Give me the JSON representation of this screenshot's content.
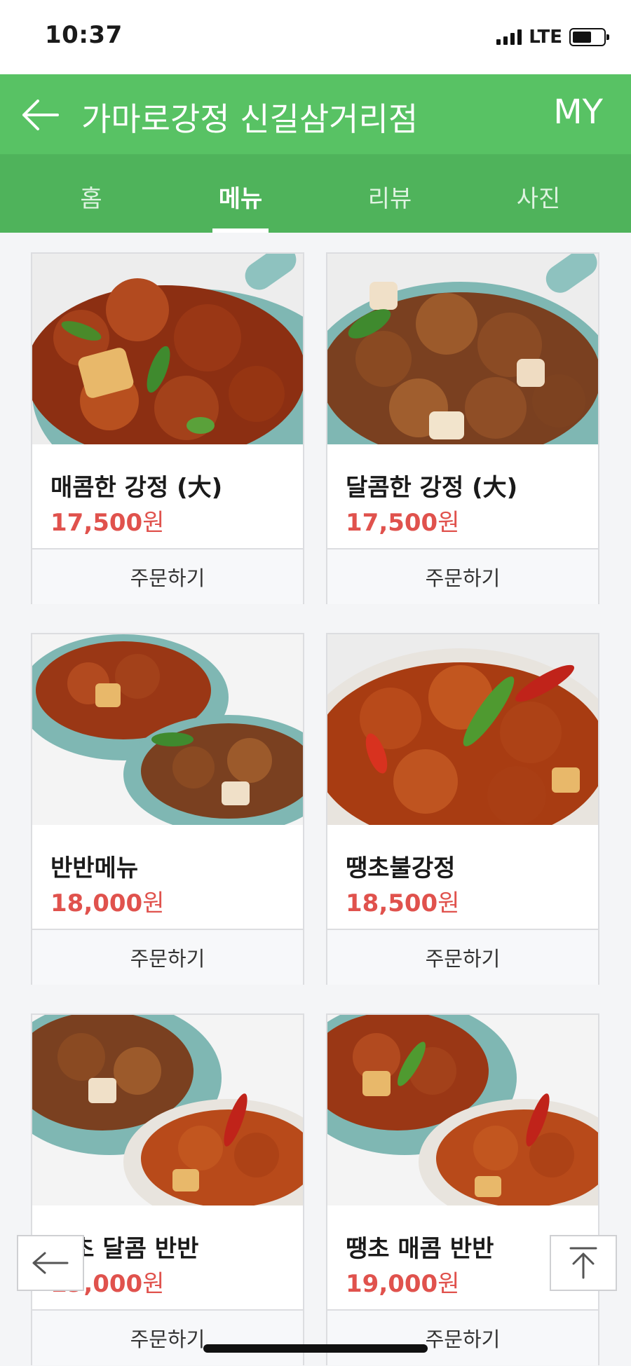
{
  "status": {
    "time": "10:37",
    "network": "LTE"
  },
  "header": {
    "title": "가마로강정 신길삼거리점",
    "my": "MY"
  },
  "tabs": [
    {
      "label": "홈"
    },
    {
      "label": "메뉴",
      "active": true
    },
    {
      "label": "리뷰"
    },
    {
      "label": "사진"
    }
  ],
  "menu": [
    {
      "name": "매콤한 강정 (大)",
      "price": "17,500",
      "currency": "원",
      "order": "주문하기"
    },
    {
      "name": "달콤한 강정 (大)",
      "price": "17,500",
      "currency": "원",
      "order": "주문하기"
    },
    {
      "name": "반반메뉴",
      "price": "18,000",
      "currency": "원",
      "order": "주문하기"
    },
    {
      "name": "땡초불강정",
      "price": "18,500",
      "currency": "원",
      "order": "주문하기"
    },
    {
      "name": "땡초 달콤 반반",
      "price": "19,000",
      "currency": "원",
      "order": "주문하기"
    },
    {
      "name": "땡초 매콤 반반",
      "price": "19,000",
      "currency": "원",
      "order": "주문하기"
    }
  ],
  "colors": {
    "brand_green": "#58c264",
    "tab_green": "#4fb35b",
    "price_red": "#e0524d"
  }
}
